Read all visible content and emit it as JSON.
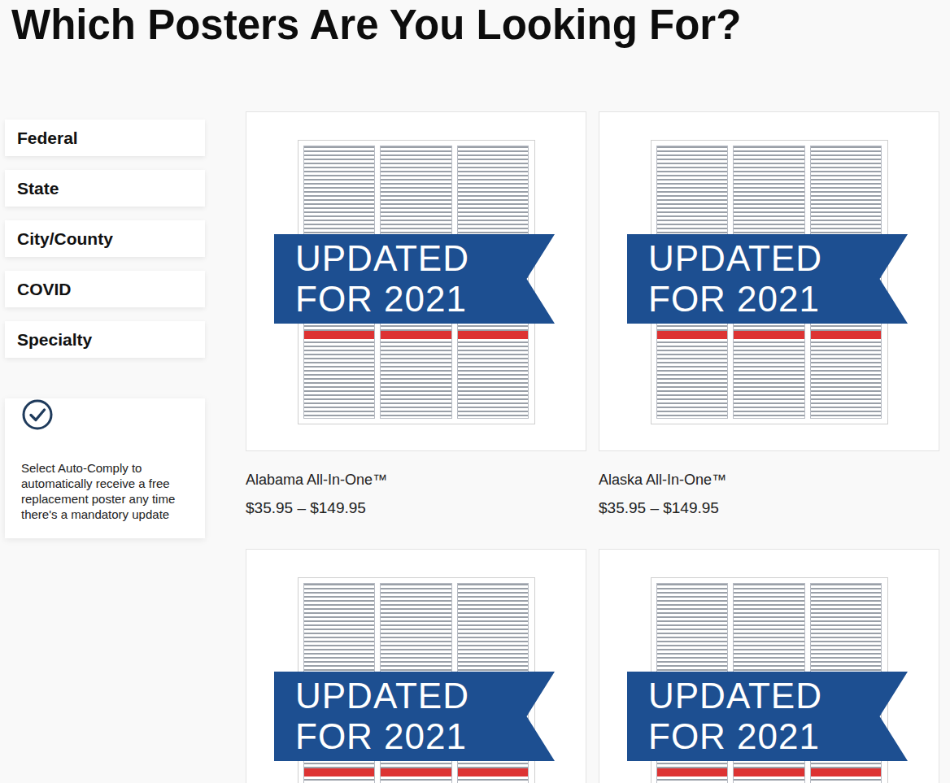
{
  "page": {
    "title": "Which Posters Are You Looking For?"
  },
  "sidebar": {
    "items": [
      {
        "label": "Federal"
      },
      {
        "label": "State"
      },
      {
        "label": "City/County"
      },
      {
        "label": "COVID"
      },
      {
        "label": "Specialty"
      }
    ]
  },
  "promo": {
    "text": "Select Auto-Comply to automatically receive a free replacement poster any time there's a mandatory update"
  },
  "products": [
    {
      "name": "Alabama All-In-One™",
      "price": "$35.95 – $149.95",
      "badge": [
        "UPDATED",
        "FOR 2021"
      ]
    },
    {
      "name": "Alaska All-In-One™",
      "price": "$35.95 – $149.95",
      "badge": [
        "UPDATED",
        "FOR 2021"
      ]
    },
    {
      "name": "",
      "price": "",
      "badge": [
        "UPDATED",
        "FOR 2021"
      ]
    },
    {
      "name": "",
      "price": "",
      "badge": [
        "UPDATED",
        "FOR 2021"
      ]
    }
  ]
}
